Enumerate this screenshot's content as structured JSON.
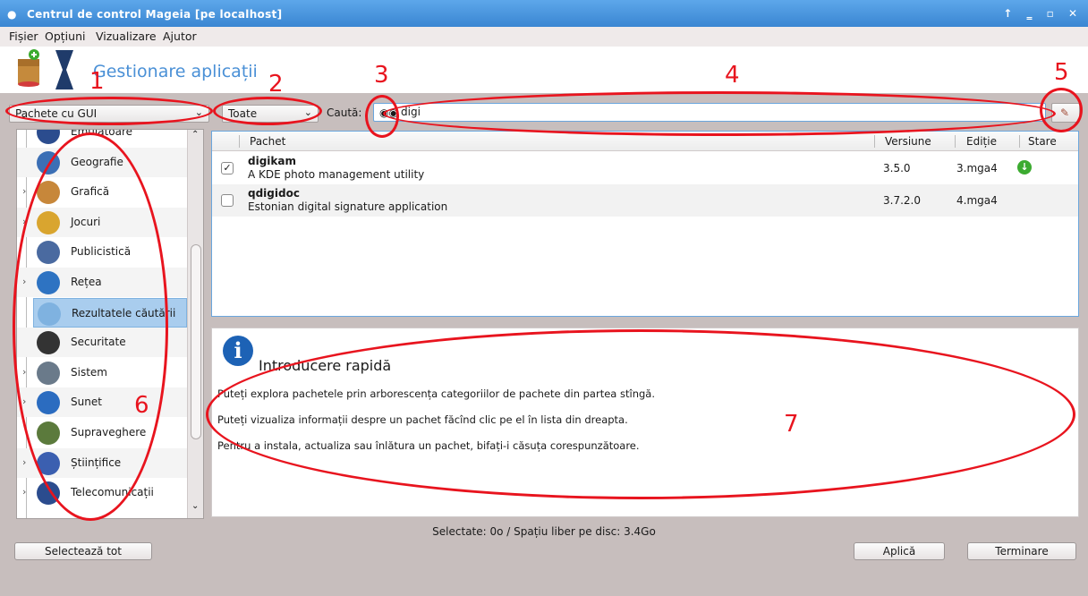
{
  "window": {
    "title": "Centrul de control Mageia  [pe localhost]",
    "controls": "↑ ‗ ▫ ✕"
  },
  "menu": [
    "Fișier",
    "Opțiuni",
    "Vizualizare",
    "Ajutor"
  ],
  "header": {
    "title": "Gestionare aplicații"
  },
  "toolbar": {
    "filter_value": "Pachete cu GUI",
    "status_value": "Toate",
    "search_label": "Caută:",
    "search_value": "digi"
  },
  "categories": [
    {
      "label": "Emulatoare",
      "expandable": false,
      "selected": false
    },
    {
      "label": "Geografie",
      "expandable": false,
      "selected": false
    },
    {
      "label": "Grafică",
      "expandable": true,
      "selected": false
    },
    {
      "label": "Jocuri",
      "expandable": true,
      "selected": false
    },
    {
      "label": "Publicistică",
      "expandable": false,
      "selected": false
    },
    {
      "label": "Rețea",
      "expandable": true,
      "selected": false
    },
    {
      "label": "Rezultatele căutării",
      "expandable": false,
      "selected": true
    },
    {
      "label": "Securitate",
      "expandable": false,
      "selected": false
    },
    {
      "label": "Sistem",
      "expandable": true,
      "selected": false
    },
    {
      "label": "Sunet",
      "expandable": true,
      "selected": false
    },
    {
      "label": "Supraveghere",
      "expandable": false,
      "selected": false
    },
    {
      "label": "Științifice",
      "expandable": true,
      "selected": false
    },
    {
      "label": "Telecomunicații",
      "expandable": true,
      "selected": false
    }
  ],
  "table": {
    "headers": [
      "Pachet",
      "Versiune",
      "Ediție",
      "Stare"
    ],
    "rows": [
      {
        "name": "digikam",
        "desc": "A KDE photo management utility",
        "version": "3.5.0",
        "edition": "3.mga4",
        "checked": true,
        "installed": true
      },
      {
        "name": "qdigidoc",
        "desc": "Estonian digital signature application",
        "version": "3.7.2.0",
        "edition": "4.mga4",
        "checked": false,
        "installed": false
      }
    ]
  },
  "info": {
    "title": "Introducere rapidă",
    "lines": [
      "Puteți explora pachetele prin arborescența categoriilor de pachete din partea stîngă.",
      "Puteți vizualiza informații despre un pachet făcînd clic pe el în lista din dreapta.",
      "Pentru a instala, actualiza sau înlătura un pachet, bifați-i căsuța corespunzătoare."
    ]
  },
  "status_text": "Selectate: 0o / Spațiu liber pe disc: 3.4Go",
  "buttons": {
    "select_all": "Selectează tot",
    "apply": "Aplică",
    "quit": "Terminare"
  },
  "annotations": [
    "1",
    "2",
    "3",
    "4",
    "5",
    "6",
    "7"
  ],
  "colors": {
    "annotation": "#e8141e",
    "title_bar": "#3a86d2",
    "selection": "#a9cdee",
    "accent_title": "#4a90d6"
  }
}
